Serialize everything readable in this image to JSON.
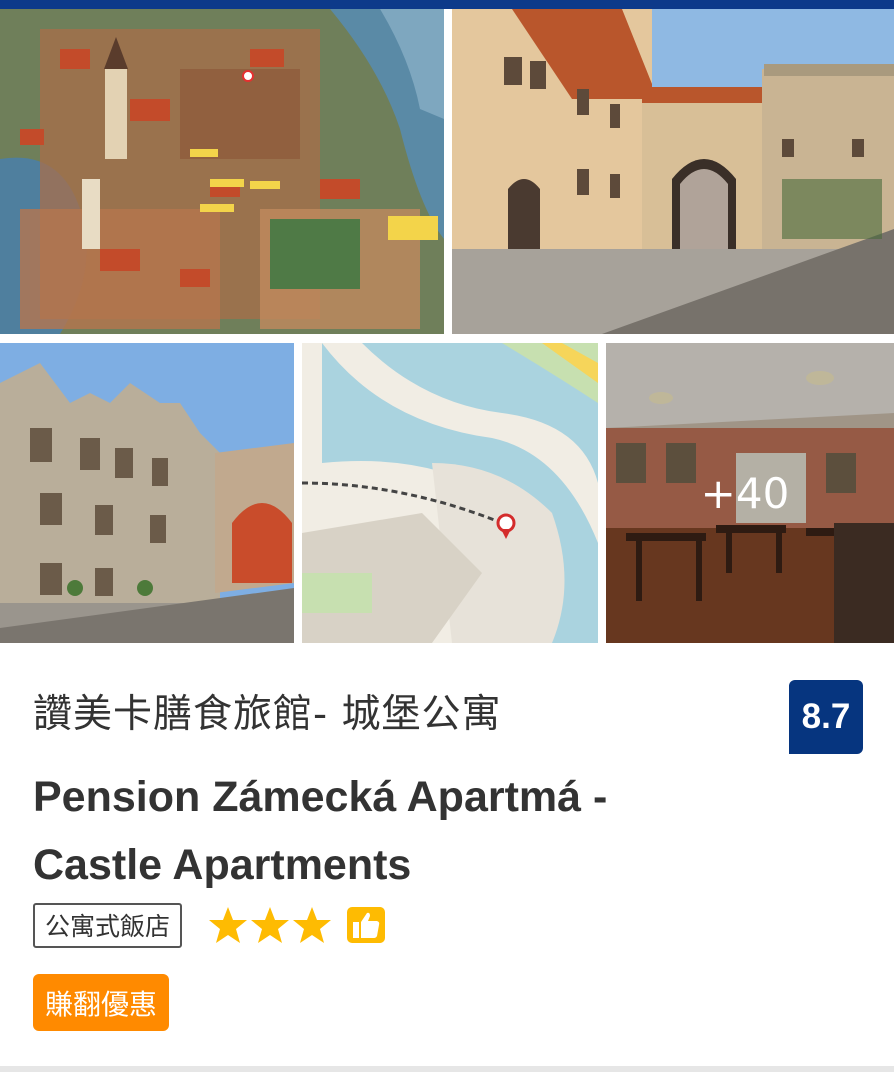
{
  "gallery": {
    "photos": [
      {
        "icon": "illustrated-town-map-photo"
      },
      {
        "icon": "castle-courtyard-photo"
      },
      {
        "icon": "castle-facade-photo"
      },
      {
        "icon": "location-map-photo"
      },
      {
        "icon": "dining-room-photo"
      }
    ],
    "more_photos_label": "+40"
  },
  "property": {
    "title_zh": "讚美卡膳食旅館- 城堡公寓",
    "title_en": "Pension Zámecká Apartmá - Castle Apartments",
    "review_score": "8.7",
    "property_type": "公寓式飯店",
    "star_rating": 3,
    "deal_label": "賺翻優惠"
  },
  "colors": {
    "brand_blue": "#06357f",
    "star_yellow": "#febb02",
    "deal_orange": "#ff8a00"
  }
}
